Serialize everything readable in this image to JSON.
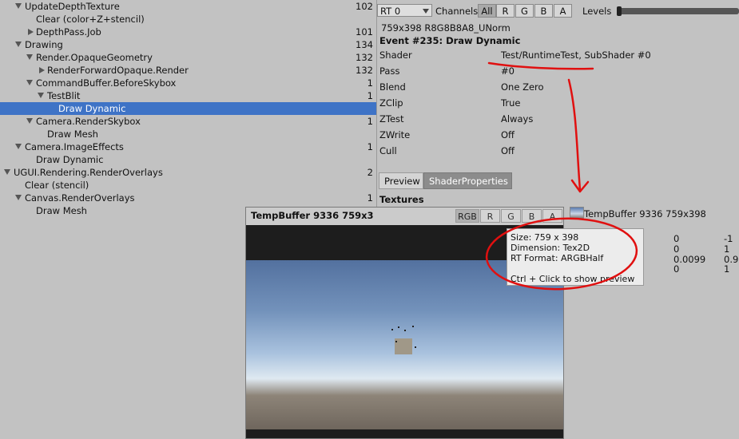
{
  "tree": {
    "rows": [
      {
        "label": "UpdateDepthTexture",
        "count": "102"
      },
      {
        "label": "Clear (color+Z+stencil)",
        "count": ""
      },
      {
        "label": "DepthPass.Job",
        "count": "101"
      },
      {
        "label": "Drawing",
        "count": "134"
      },
      {
        "label": "Render.OpaqueGeometry",
        "count": "132"
      },
      {
        "label": "RenderForwardOpaque.Render",
        "count": "132"
      },
      {
        "label": "CommandBuffer.BeforeSkybox",
        "count": "1"
      },
      {
        "label": "TestBlit",
        "count": "1"
      },
      {
        "label": "Draw Dynamic",
        "count": ""
      },
      {
        "label": "Camera.RenderSkybox",
        "count": "1"
      },
      {
        "label": "Draw Mesh",
        "count": ""
      },
      {
        "label": "Camera.ImageEffects",
        "count": "1"
      },
      {
        "label": "Draw Dynamic",
        "count": ""
      },
      {
        "label": "UGUI.Rendering.RenderOverlays",
        "count": "2"
      },
      {
        "label": "Clear (stencil)",
        "count": ""
      },
      {
        "label": "Canvas.RenderOverlays",
        "count": "1"
      },
      {
        "label": "Draw Mesh",
        "count": ""
      }
    ]
  },
  "toolbar": {
    "rt_value": "RT 0",
    "channels_label": "Channels",
    "channel_buttons": [
      "All",
      "R",
      "G",
      "B",
      "A"
    ],
    "levels_label": "Levels"
  },
  "info": {
    "format": "759x398 R8G8B8A8_UNorm",
    "event_title": "Event #235: Draw Dynamic",
    "props": [
      {
        "k": "Shader",
        "v": "Test/RuntimeTest, SubShader #0"
      },
      {
        "k": "Pass",
        "v": "#0"
      },
      {
        "k": "Blend",
        "v": "One Zero"
      },
      {
        "k": "ZClip",
        "v": "True"
      },
      {
        "k": "ZTest",
        "v": "Always"
      },
      {
        "k": "ZWrite",
        "v": "Off"
      },
      {
        "k": "Cull",
        "v": "Off"
      }
    ],
    "tabs": [
      "Preview",
      "ShaderProperties"
    ],
    "textures_label": "Textures",
    "texture_name": "TempBuffer 9336 759x398",
    "matrix": [
      [
        "0",
        "-1"
      ],
      [
        "0",
        "1"
      ],
      [
        "0.0099",
        "0.9"
      ],
      [
        "0",
        "1"
      ]
    ]
  },
  "preview": {
    "title": "TempBuffer 9336 759x3",
    "channels": [
      "RGB",
      "R",
      "G",
      "B",
      "A"
    ]
  },
  "tooltip": {
    "size": "Size: 759 x 398",
    "dimension": "Dimension: Tex2D",
    "rt_format": "RT Format: ARGBHalf",
    "hint": "Ctrl + Click to show preview"
  },
  "colors": {
    "selection": "#3e73c6",
    "annotation": "#e01010"
  }
}
